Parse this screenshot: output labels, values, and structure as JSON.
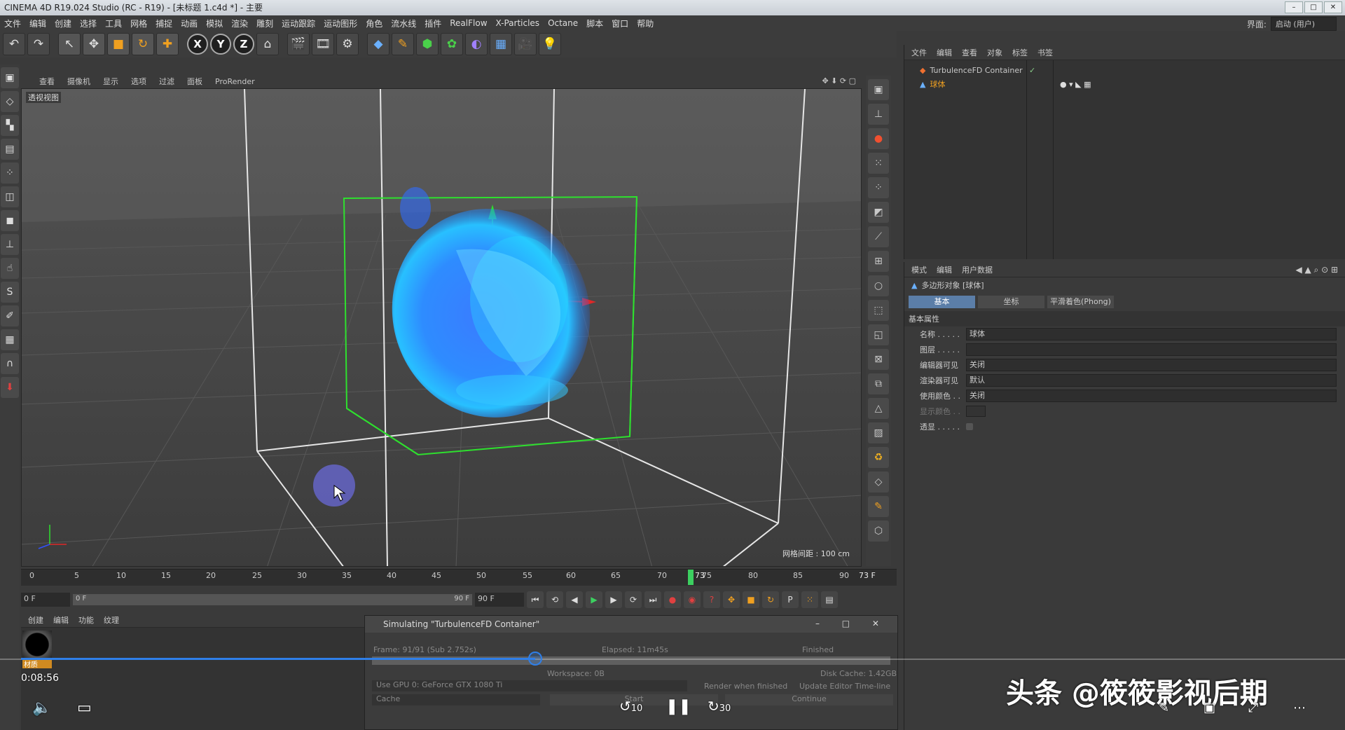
{
  "window": {
    "title": "CINEMA 4D R19.024 Studio (RC - R19) - [未标题 1.c4d *] - 主要"
  },
  "menu": [
    "文件",
    "编辑",
    "创建",
    "选择",
    "工具",
    "网格",
    "捕捉",
    "动画",
    "模拟",
    "渲染",
    "雕刻",
    "运动跟踪",
    "运动图形",
    "角色",
    "流水线",
    "插件",
    "RealFlow",
    "X-Particles",
    "Octane",
    "脚本",
    "窗口",
    "帮助"
  ],
  "layout": {
    "label": "界面:",
    "value": "启动 (用户)"
  },
  "toolbar": {
    "x": "X",
    "y": "Y",
    "z": "Z"
  },
  "viewport": {
    "menu": [
      "查看",
      "摄像机",
      "显示",
      "选项",
      "过滤",
      "面板",
      "ProRender"
    ],
    "view_name": "透视视图",
    "grid_spacing": "网格间距 : 100 cm"
  },
  "object_manager": {
    "menu": [
      "文件",
      "编辑",
      "查看",
      "对象",
      "标签",
      "书签"
    ],
    "objects": [
      {
        "name": "TurbulenceFD Container"
      },
      {
        "name": "球体"
      }
    ]
  },
  "attributes": {
    "menu": [
      "模式",
      "编辑",
      "用户数据"
    ],
    "object_title": "多边形对象 [球体]",
    "tabs": [
      "基本",
      "坐标",
      "平滑着色(Phong)"
    ],
    "section": "基本属性",
    "rows": [
      {
        "label": "名称 . . . . .",
        "value": "球体"
      },
      {
        "label": "图层 . . . . .",
        "value": ""
      },
      {
        "label": "编辑器可见",
        "value": "关闭"
      },
      {
        "label": "渲染器可见",
        "value": "默认"
      },
      {
        "label": "使用颜色 . .",
        "value": "关闭"
      },
      {
        "label": "显示颜色 . .",
        "value": ""
      },
      {
        "label": "透显 . . . . .",
        "value": ""
      }
    ]
  },
  "timeline": {
    "ticks": [
      "0",
      "5",
      "10",
      "15",
      "20",
      "25",
      "30",
      "35",
      "40",
      "45",
      "50",
      "55",
      "60",
      "65",
      "70",
      "75",
      "80",
      "85",
      "90"
    ],
    "current_marker": "73",
    "current_frame": "73 F",
    "start": "0 F",
    "range_start": "0 F",
    "range_end": "90 F",
    "end": "90 F"
  },
  "material_manager": {
    "menu": [
      "创建",
      "编辑",
      "功能",
      "纹理"
    ],
    "material_name": "材质"
  },
  "sim_window": {
    "title": "Simulating \"TurbulenceFD Container\"",
    "frame": "Frame: 91/91 (Sub 2.752s)",
    "elapsed": "Elapsed: 11m45s",
    "status": "Finished",
    "workspace": "Workspace: 0B",
    "disk_cache": "Disk Cache: 1.42GB",
    "gpu": "Use GPU 0: GeForce GTX 1080 Ti",
    "render_when_finished": "Render when finished",
    "update_editor": "Update Editor Time-line",
    "cache": "Cache",
    "start_btn": "Start",
    "continue_btn": "Continue"
  },
  "video_overlay": {
    "time": "0:08:56",
    "rewind": "10",
    "forward": "30",
    "watermark": "头条 @筱筱影视后期",
    "progress": 0.39
  }
}
